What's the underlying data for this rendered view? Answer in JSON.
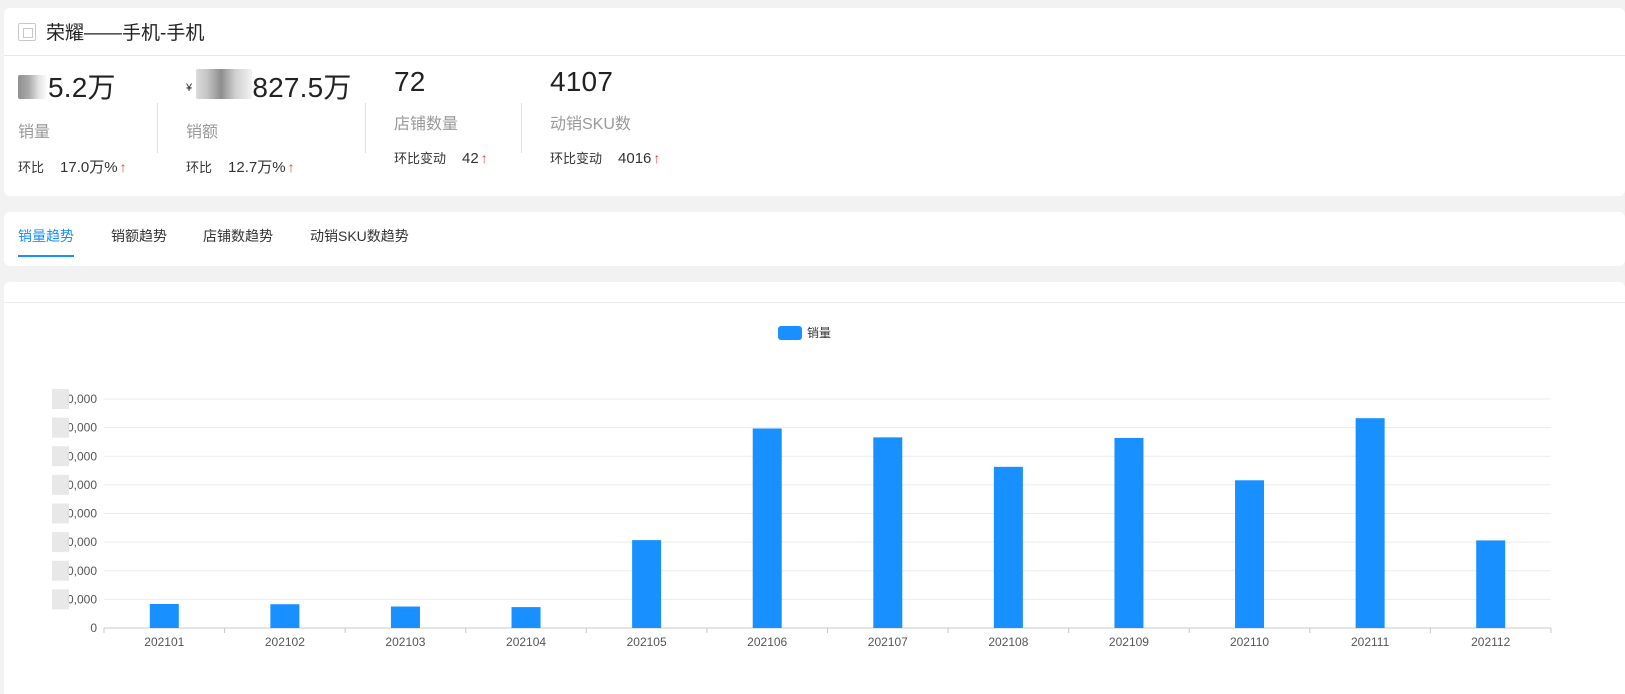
{
  "header": {
    "title": "荣耀——手机-手机",
    "icon": "brand-icon"
  },
  "metrics": [
    {
      "value_visible": "5.2万",
      "currency": "",
      "label": "销量",
      "compare_label": "环比",
      "compare_value": "17.0万%",
      "arrow": "↑"
    },
    {
      "value_visible": "827.5万",
      "currency": "¥",
      "label": "销额",
      "compare_label": "环比",
      "compare_value": "12.7万%",
      "arrow": "↑"
    },
    {
      "value_visible": "72",
      "currency": "",
      "label": "店铺数量",
      "compare_label": "环比变动",
      "compare_value": "42",
      "arrow": "↑"
    },
    {
      "value_visible": "4107",
      "currency": "",
      "label": "动销SKU数",
      "compare_label": "环比变动",
      "compare_value": "4016",
      "arrow": "↑"
    }
  ],
  "tabs": [
    {
      "label": "销量趋势",
      "active": true
    },
    {
      "label": "销额趋势",
      "active": false
    },
    {
      "label": "店铺数趋势",
      "active": false
    },
    {
      "label": "动销SKU数趋势",
      "active": false
    }
  ],
  "colors": {
    "accent": "#1890ff",
    "up_arrow": "#e8413a"
  },
  "chart_data": {
    "type": "bar",
    "legend": [
      "销量"
    ],
    "legend_position": "top-center",
    "categories": [
      "202101",
      "202102",
      "202103",
      "202104",
      "202105",
      "202106",
      "202107",
      "202108",
      "202109",
      "202110",
      "202111",
      "202112"
    ],
    "series": [
      {
        "name": "销量",
        "color": "#1890ff",
        "values": [
          0.84,
          0.83,
          0.75,
          0.73,
          3.07,
          6.97,
          6.66,
          5.63,
          6.64,
          5.16,
          7.33,
          3.06
        ]
      }
    ],
    "y_ticks_visible": [
      "0",
      "0,000",
      "0,000",
      "0,000",
      "0,000",
      "0,000",
      "0,000",
      "0,000",
      "0,000"
    ],
    "y_ticks_note": "leading digits obscured in source",
    "ylim": [
      0,
      8
    ],
    "grid": true
  }
}
